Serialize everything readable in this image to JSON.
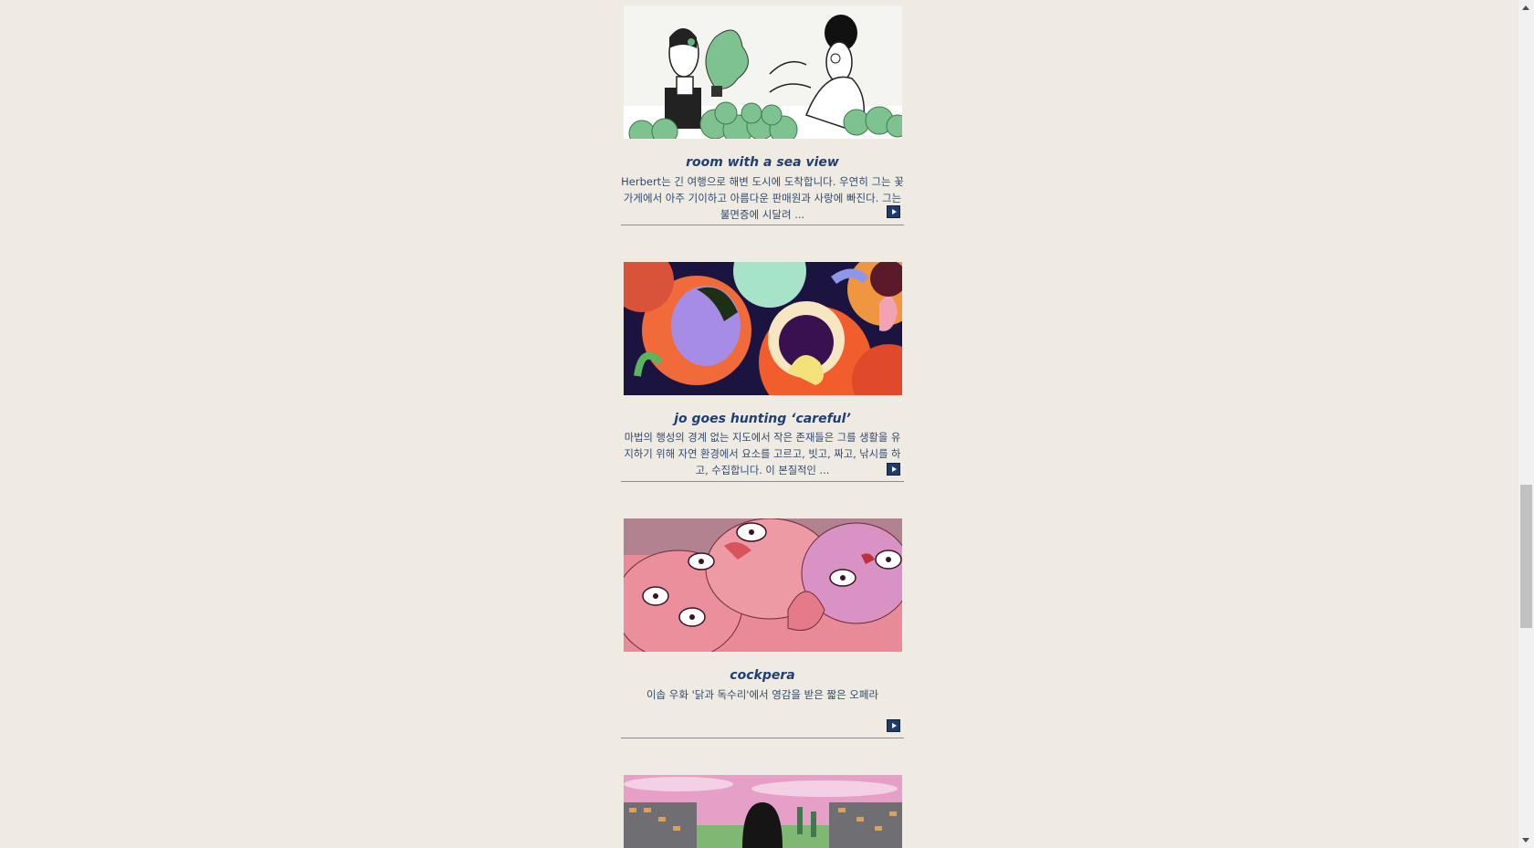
{
  "items": [
    {
      "title": "room with a sea view",
      "description": "Herbert는 긴 여행으로 해변 도시에 도착합니다. 우연히 그는 꽃가게에서 아주 기이하고 아름다운 판매원과 사랑에 빠진다. 그는 불면증에 시달려 ...",
      "more_icon": "play-arrow-icon"
    },
    {
      "title": "jo goes hunting ‘careful’",
      "description": "마법의 행성의 경계 없는 지도에서 작은 존재들은 그를 생활을 유지하기 위해 자연 환경에서 요소를 고르고, 빗고, 짜고, 낚시를 하고, 수집합니다. 이 본질적인 ...",
      "more_icon": "play-arrow-icon"
    },
    {
      "title": "cockpera",
      "description": "이솝 우화 '닭과 독수리'에서 영감을 받은 짧은 오페라",
      "more_icon": "play-arrow-icon"
    }
  ],
  "colors": {
    "background": "#f0ebe2",
    "title": "#1e3f73",
    "description": "#2e4a70",
    "button": "#1d3c6b"
  }
}
